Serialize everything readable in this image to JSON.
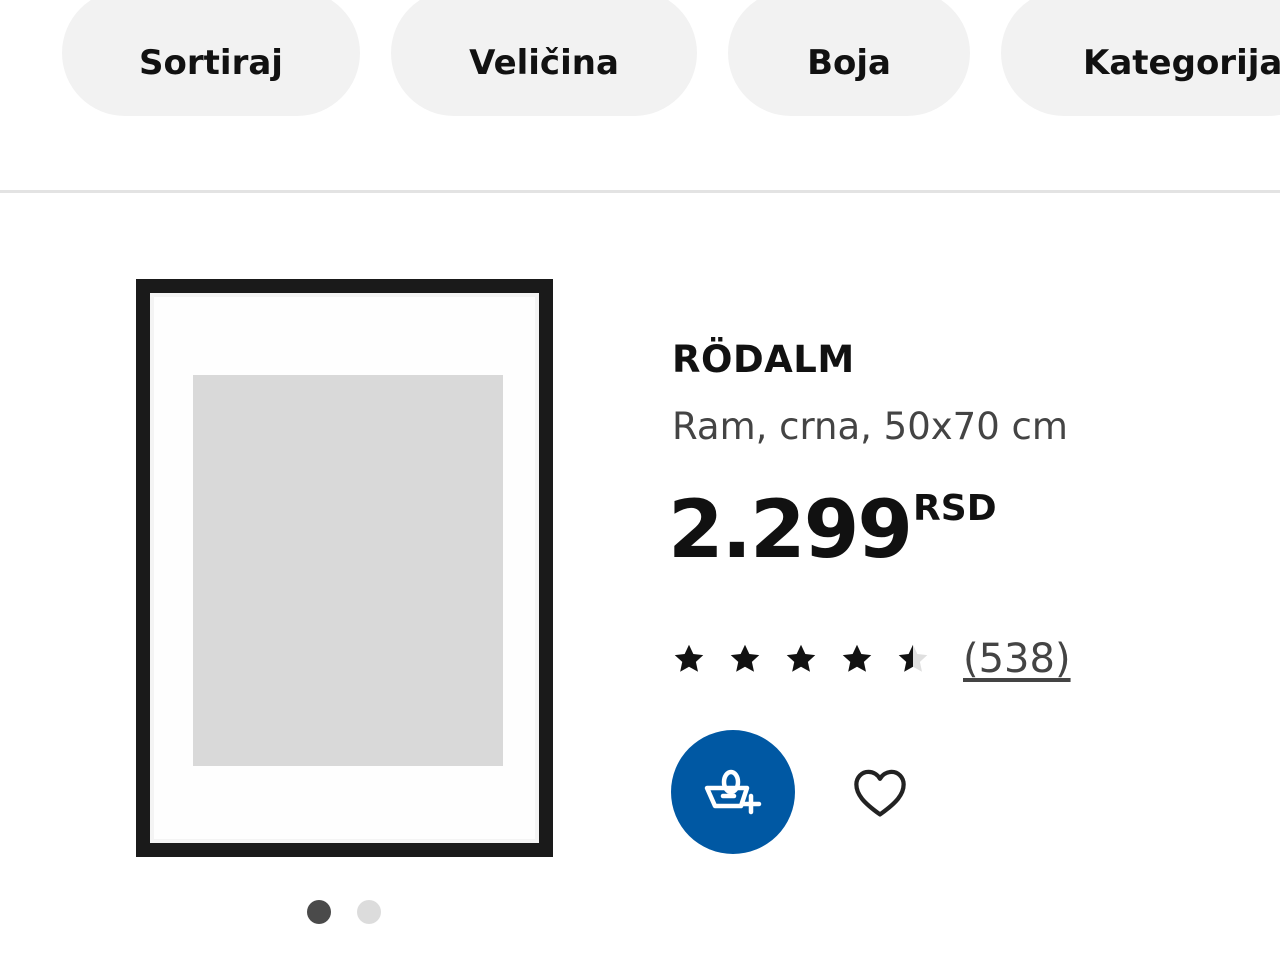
{
  "filters": {
    "sort_label": "Sortiraj",
    "size_label": "Veličina",
    "color_label": "Boja",
    "category_label": "Kategorija"
  },
  "product": {
    "name": "RÖDALM",
    "description": "Ram, crna, 50x70 cm",
    "price": "2.299",
    "currency": "RSD",
    "rating": 4.5,
    "rating_max": 5,
    "review_count": "(538)",
    "image_count": 2,
    "active_image": 1
  },
  "actions": {
    "add_to_cart_icon": "shopping-basket-add-icon",
    "favorite_icon": "heart-outline-icon"
  },
  "colors": {
    "primary_blue": "#0058a3",
    "chip_background": "#f2f2f2",
    "star_filled": "#111111",
    "star_empty": "#dfdfdf"
  }
}
